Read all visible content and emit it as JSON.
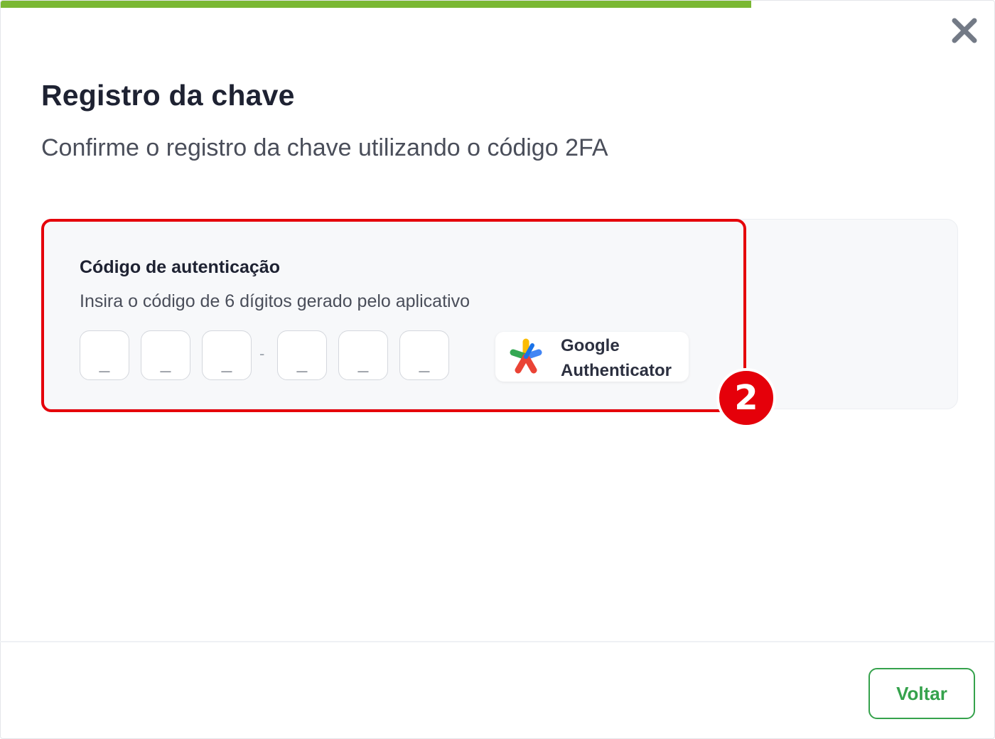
{
  "progress": {
    "fraction": 0.754,
    "color": "#7ab833"
  },
  "modal": {
    "title": "Registro da chave",
    "subtitle": "Confirme o registro da chave utilizando o código 2FA",
    "close_icon": "close-icon"
  },
  "auth_card": {
    "title": "Código de autenticação",
    "description": "Insira o código de 6 dígitos gerado pelo aplicativo",
    "digits": [
      {
        "value": "",
        "placeholder": "_"
      },
      {
        "value": "",
        "placeholder": "_"
      },
      {
        "value": "",
        "placeholder": "_"
      },
      {
        "value": "",
        "placeholder": "_"
      },
      {
        "value": "",
        "placeholder": "_"
      },
      {
        "value": "",
        "placeholder": "_"
      }
    ],
    "separator": "-",
    "authenticator": {
      "line1": "Google",
      "line2": "Authenticator",
      "icon": "google-authenticator-icon"
    }
  },
  "annotation": {
    "step": "2",
    "color": "#e5000a"
  },
  "footer": {
    "back_label": "Voltar",
    "accent": "#35a24c"
  }
}
